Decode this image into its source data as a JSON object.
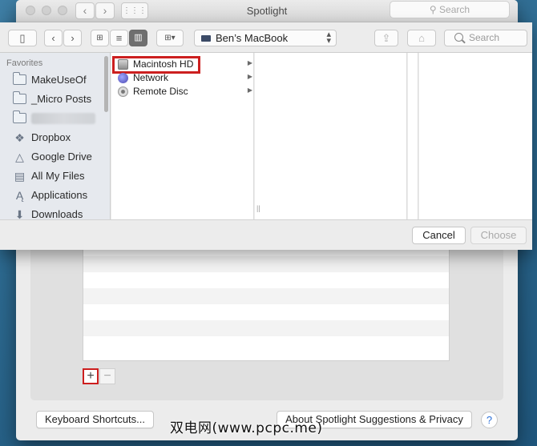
{
  "prefs_window": {
    "title": "Spotlight",
    "search_placeholder": "Search",
    "keyboard_shortcuts_label": "Keyboard Shortcuts...",
    "about_label": "About Spotlight Suggestions & Privacy",
    "help_label": "?",
    "add_label": "+",
    "remove_label": "−"
  },
  "dialog": {
    "location": "Ben’s MacBook",
    "search_placeholder": "Search",
    "sidebar": {
      "heading": "Favorites",
      "items": [
        {
          "label": "MakeUseOf",
          "icon": "folder-icon"
        },
        {
          "label": "_Micro Posts",
          "icon": "folder-icon"
        },
        {
          "label": "",
          "icon": "folder-icon"
        },
        {
          "label": "Dropbox",
          "icon": "dropbox-icon"
        },
        {
          "label": "Google Drive",
          "icon": "google-drive-icon"
        },
        {
          "label": "All My Files",
          "icon": "all-files-icon"
        },
        {
          "label": "Applications",
          "icon": "applications-icon"
        },
        {
          "label": "Downloads",
          "icon": "downloads-icon"
        }
      ]
    },
    "column_items": [
      {
        "label": "Macintosh HD",
        "icon": "hard-disk-icon",
        "highlighted": true
      },
      {
        "label": "Network",
        "icon": "network-icon",
        "highlighted": false
      },
      {
        "label": "Remote Disc",
        "icon": "remote-disc-icon",
        "highlighted": false
      }
    ],
    "cancel_label": "Cancel",
    "choose_label": "Choose"
  },
  "watermark": "双电网(www.pcpc.me)",
  "colors": {
    "highlight_red": "#cc1f1f",
    "desktop_blue": "#2d6a90",
    "window_gray": "#ececec"
  }
}
